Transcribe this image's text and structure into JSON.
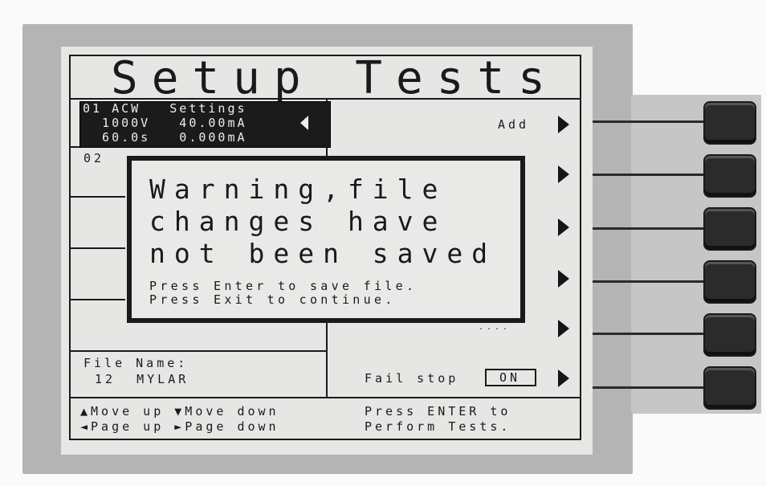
{
  "screen": {
    "title": "Setup Tests",
    "step_01": {
      "header": "01 ACW   Settings",
      "line2": "  1000V   40.00mA",
      "line3": "  60.0s   0.000mA"
    },
    "step_02_label": "02",
    "softkey_labels": {
      "add": "Add",
      "partial": "....",
      "fail_stop": "Fail stop",
      "fail_stop_value": "ON"
    },
    "file": {
      "label": "File Name:",
      "value": "12  MYLAR"
    },
    "help": {
      "line1": "▲Move up ▼Move down",
      "line2": "◄Page up ►Page down",
      "enter_line1": "Press ENTER to",
      "enter_line2": "Perform Tests."
    }
  },
  "dialog": {
    "line1": "Warning,file",
    "line2": "changes have",
    "line3": "not been saved",
    "instr1": "Press Enter to save file.",
    "instr2": "Press Exit to continue."
  },
  "icons": {
    "softkey_arrow": "triangle-right",
    "cursor": "triangle-left"
  },
  "colors": {
    "lcd_background": "#e6e6e4",
    "lcd_ink": "#1a1a1a",
    "bezel": "#b4b4b4",
    "key": "#2b2b2b"
  }
}
